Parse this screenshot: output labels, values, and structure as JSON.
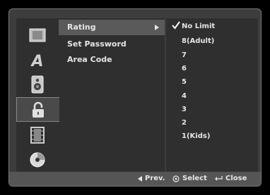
{
  "sidebar": {
    "icons": [
      {
        "name": "disc-icon"
      },
      {
        "name": "language-icon",
        "letter": "A"
      },
      {
        "name": "speaker-icon"
      },
      {
        "name": "lock-icon",
        "selected": true
      },
      {
        "name": "film-icon"
      },
      {
        "name": "dvd-icon"
      }
    ]
  },
  "menu": {
    "items": [
      {
        "label": "Rating",
        "selected": true
      },
      {
        "label": "Set Password"
      },
      {
        "label": "Area Code"
      }
    ]
  },
  "options": {
    "items": [
      "No Limit",
      "8(Adult)",
      "7",
      "6",
      "5",
      "4",
      "3",
      "2",
      "1(Kids)"
    ],
    "checked_index": 0
  },
  "footer": {
    "prev_label": "Prev.",
    "select_label": "Select",
    "close_label": "Close"
  }
}
